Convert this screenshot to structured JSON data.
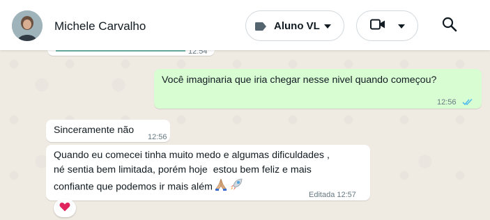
{
  "header": {
    "contact_name": "Michele Carvalho",
    "label_pill": {
      "icon": "label-tag-icon",
      "text": "Aluno VL"
    },
    "video_pill": {
      "icon": "video-camera-icon"
    },
    "search": {
      "icon": "search-icon"
    }
  },
  "messages": {
    "partial_time": "12:54",
    "outgoing": {
      "text": "Você imaginaria que iria chegar nesse nivel quando começou?",
      "time": "12:56",
      "status_icon": "double-check-read-icon"
    },
    "incoming_1": {
      "text": "Sinceramente não",
      "time": "12:56"
    },
    "incoming_2": {
      "lines": [
        "Quando eu comecei tinha muito medo e algumas dificuldades ,",
        "né sentia bem limitada, porém hoje  estou bem feliz e mais",
        "confiante que podemos ir mais além"
      ],
      "emoji_icons": [
        "praying-hands-icon",
        "rocket-icon"
      ],
      "time": "Editada 12:57"
    },
    "reaction": {
      "icon": "red-heart-icon"
    }
  },
  "colors": {
    "outgoing_bubble": "#d9fdd3",
    "incoming_bubble": "#ffffff",
    "wallpaper": "#efeae2",
    "read_ticks": "#53bdeb",
    "tag_icon": "#54656f"
  }
}
